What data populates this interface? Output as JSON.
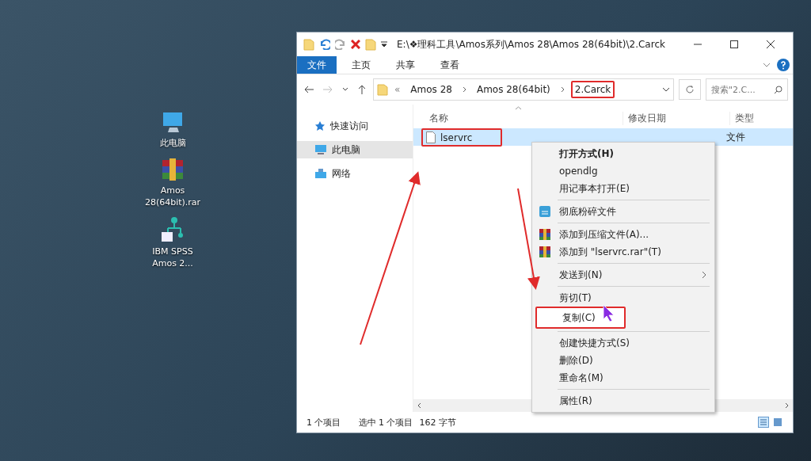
{
  "desktop_icons": [
    {
      "kind": "computer",
      "label": "此电脑"
    },
    {
      "kind": "archive",
      "label": "Amos 28(64bit).rar"
    },
    {
      "kind": "shortcut",
      "label": "IBM SPSS Amos 2..."
    }
  ],
  "window": {
    "title": "E:\\❖理科工具\\Amos系列\\Amos 28\\Amos 28(64bit)\\2.Carck"
  },
  "ribbon_tabs": [
    {
      "label": "文件",
      "selected": true
    },
    {
      "label": "主页",
      "selected": false
    },
    {
      "label": "共享",
      "selected": false
    },
    {
      "label": "查看",
      "selected": false
    }
  ],
  "address_bar": {
    "overflow": "«",
    "crumbs": [
      {
        "label": "Amos 28",
        "highlighted": false
      },
      {
        "label": "Amos 28(64bit)",
        "highlighted": false
      },
      {
        "label": "2.Carck",
        "highlighted": true
      }
    ]
  },
  "search": {
    "placeholder": "搜索\"2.C..."
  },
  "nav_pane": [
    {
      "kind": "star",
      "label": "快速访问",
      "selected": false
    },
    {
      "kind": "computer",
      "label": "此电脑",
      "selected": true
    },
    {
      "kind": "network",
      "label": "网络",
      "selected": false
    }
  ],
  "table": {
    "columns": [
      "名称",
      "修改日期",
      "类型"
    ],
    "rows": [
      {
        "name": "lservrc",
        "type": "文件",
        "selected": true,
        "highlighted": true
      }
    ]
  },
  "context_menu": [
    {
      "kind": "item",
      "label": "打开方式(H)",
      "bold": true,
      "highlighted": false
    },
    {
      "kind": "item",
      "label": "opendlg",
      "bold": false,
      "highlighted": false
    },
    {
      "kind": "item",
      "label": "用记事本打开(E)",
      "bold": false,
      "highlighted": false
    },
    {
      "kind": "separator"
    },
    {
      "kind": "shredder",
      "label": "彻底粉碎文件",
      "bold": false,
      "highlighted": false
    },
    {
      "kind": "separator"
    },
    {
      "kind": "archive",
      "label": "添加到压缩文件(A)...",
      "bold": false,
      "highlighted": false
    },
    {
      "kind": "archive",
      "label": "添加到 \"lservrc.rar\"(T)",
      "bold": false,
      "highlighted": false
    },
    {
      "kind": "separator"
    },
    {
      "kind": "submenu",
      "label": "发送到(N)",
      "bold": false,
      "highlighted": false
    },
    {
      "kind": "separator"
    },
    {
      "kind": "item",
      "label": "剪切(T)",
      "bold": false,
      "highlighted": false
    },
    {
      "kind": "item",
      "label": "复制(C)",
      "bold": false,
      "highlighted": true
    },
    {
      "kind": "separator"
    },
    {
      "kind": "item",
      "label": "创建快捷方式(S)",
      "bold": false,
      "highlighted": false
    },
    {
      "kind": "item",
      "label": "删除(D)",
      "bold": false,
      "highlighted": false
    },
    {
      "kind": "item",
      "label": "重命名(M)",
      "bold": false,
      "highlighted": false
    },
    {
      "kind": "separator"
    },
    {
      "kind": "item",
      "label": "属性(R)",
      "bold": false,
      "highlighted": false
    }
  ],
  "status_bar": [
    "1 个项目",
    "选中 1 个项目",
    "162 字节"
  ]
}
